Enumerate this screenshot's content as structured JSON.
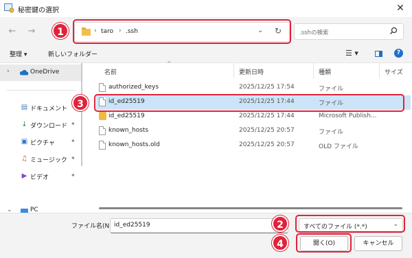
{
  "window": {
    "title": "秘密鍵の選択",
    "close_glyph": "✕"
  },
  "nav": {
    "back": "←",
    "forward": "→",
    "up": "↑"
  },
  "address": {
    "crumbs": [
      "taro",
      ".ssh"
    ],
    "separator": "›",
    "dropdown_glyph": "⌄",
    "refresh_glyph": "↻"
  },
  "search": {
    "placeholder": ".sshの検索",
    "icon": "search-icon"
  },
  "toolbar": {
    "organize": "整理 ▾",
    "new_folder": "新しいフォルダー",
    "view_glyph": "☰ ▾",
    "help_glyph": "?"
  },
  "sidebar": {
    "onedrive": "OneDrive",
    "items": [
      {
        "label": "ドキュメント",
        "icon": "▤"
      },
      {
        "label": "ダウンロード",
        "icon": "↓"
      },
      {
        "label": "ピクチャ",
        "icon": "▣"
      },
      {
        "label": "ミュージック",
        "icon": "♫"
      },
      {
        "label": "ビデオ",
        "icon": "▶"
      }
    ],
    "pc": "PC",
    "pin_glyph": "📌"
  },
  "columns": {
    "name": "名前",
    "date": "更新日時",
    "type": "種類",
    "size": "サイズ",
    "sort_glyph": "^"
  },
  "files": [
    {
      "name": "authorized_keys",
      "date": "2025/12/25 17:54",
      "type": "ファイル",
      "size": ""
    },
    {
      "name": "id_ed25519",
      "date": "2025/12/25 17:44",
      "type": "ファイル",
      "size": ""
    },
    {
      "name": "id_ed25519",
      "date": "2025/12/25 17:44",
      "type": "Microsoft Publish...",
      "size": ""
    },
    {
      "name": "known_hosts",
      "date": "2025/12/25 20:57",
      "type": "ファイル",
      "size": ""
    },
    {
      "name": "known_hosts.old",
      "date": "2025/12/25 20:57",
      "type": "OLD ファイル",
      "size": ""
    }
  ],
  "bottom": {
    "filename_label": "ファイル名(N):",
    "filename_value": "id_ed25519",
    "filter_value": "すべてのファイル (*.*)",
    "open_label": "開く(O)",
    "cancel_label": "キャンセル"
  },
  "steps": [
    "1",
    "2",
    "3",
    "4"
  ],
  "colors": {
    "highlight": "#e0223a",
    "selection": "#cce4f7",
    "accent": "#1f6fd0"
  }
}
